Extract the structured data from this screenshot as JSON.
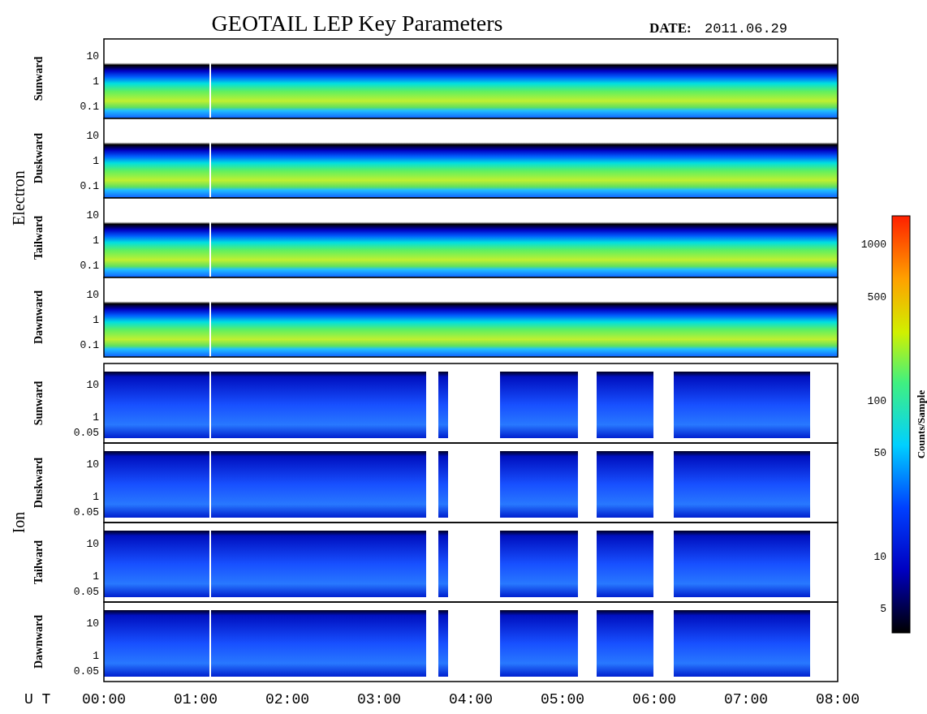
{
  "title": "GEOTAIL LEP Key Parameters",
  "date_label": "DATE:",
  "date": "2011.06.29",
  "groups": [
    {
      "name": "Electron",
      "kind": "electron",
      "panels": [
        {
          "label": "Sunward",
          "yticks": [
            "10",
            "1",
            "0.1"
          ]
        },
        {
          "label": "Duskward",
          "yticks": [
            "10",
            "1",
            "0.1"
          ]
        },
        {
          "label": "Tailward",
          "yticks": [
            "10",
            "1",
            "0.1"
          ]
        },
        {
          "label": "Dawnward",
          "yticks": [
            "10",
            "1",
            "0.1"
          ]
        }
      ]
    },
    {
      "name": "Ion",
      "kind": "ion",
      "panels": [
        {
          "label": "Sunward",
          "yticks": [
            "10",
            "1",
            "0.05"
          ]
        },
        {
          "label": "Duskward",
          "yticks": [
            "10",
            "1",
            "0.05"
          ]
        },
        {
          "label": "Tailward",
          "yticks": [
            "10",
            "1",
            "0.05"
          ]
        },
        {
          "label": "Dawnward",
          "yticks": [
            "10",
            "1",
            "0.05"
          ]
        }
      ]
    }
  ],
  "x_axis": {
    "label": "U T",
    "ticks": [
      "00:00",
      "01:00",
      "02:00",
      "03:00",
      "04:00",
      "05:00",
      "06:00",
      "07:00",
      "08:00"
    ]
  },
  "colorbar": {
    "label": "Counts/Sample",
    "ticks": [
      "1000",
      "500",
      "100",
      "50",
      "10",
      "5"
    ]
  }
}
